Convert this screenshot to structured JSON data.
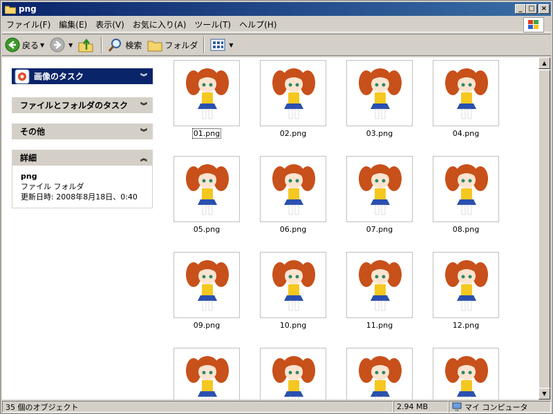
{
  "window": {
    "title": "png"
  },
  "menu": [
    "ファイル(F)",
    "編集(E)",
    "表示(V)",
    "お気に入り(A)",
    "ツール(T)",
    "ヘルプ(H)"
  ],
  "toolbar": {
    "back": "戻る",
    "search": "検索",
    "folders": "フォルダ"
  },
  "sidebar": {
    "image_tasks": "画像のタスク",
    "file_folder_tasks": "ファイルとフォルダのタスク",
    "other": "その他",
    "details": {
      "title": "詳細",
      "name": "png",
      "type": "ファイル フォルダ",
      "modified": "更新日時: 2008年8月18日、0:40"
    }
  },
  "files": [
    "01.png",
    "02.png",
    "03.png",
    "04.png",
    "05.png",
    "06.png",
    "07.png",
    "08.png",
    "09.png",
    "10.png",
    "11.png",
    "12.png",
    "",
    "",
    "",
    ""
  ],
  "status": {
    "count": "35 個のオブジェクト",
    "size": "2.94 MB",
    "location": "マイ コンピュータ"
  }
}
